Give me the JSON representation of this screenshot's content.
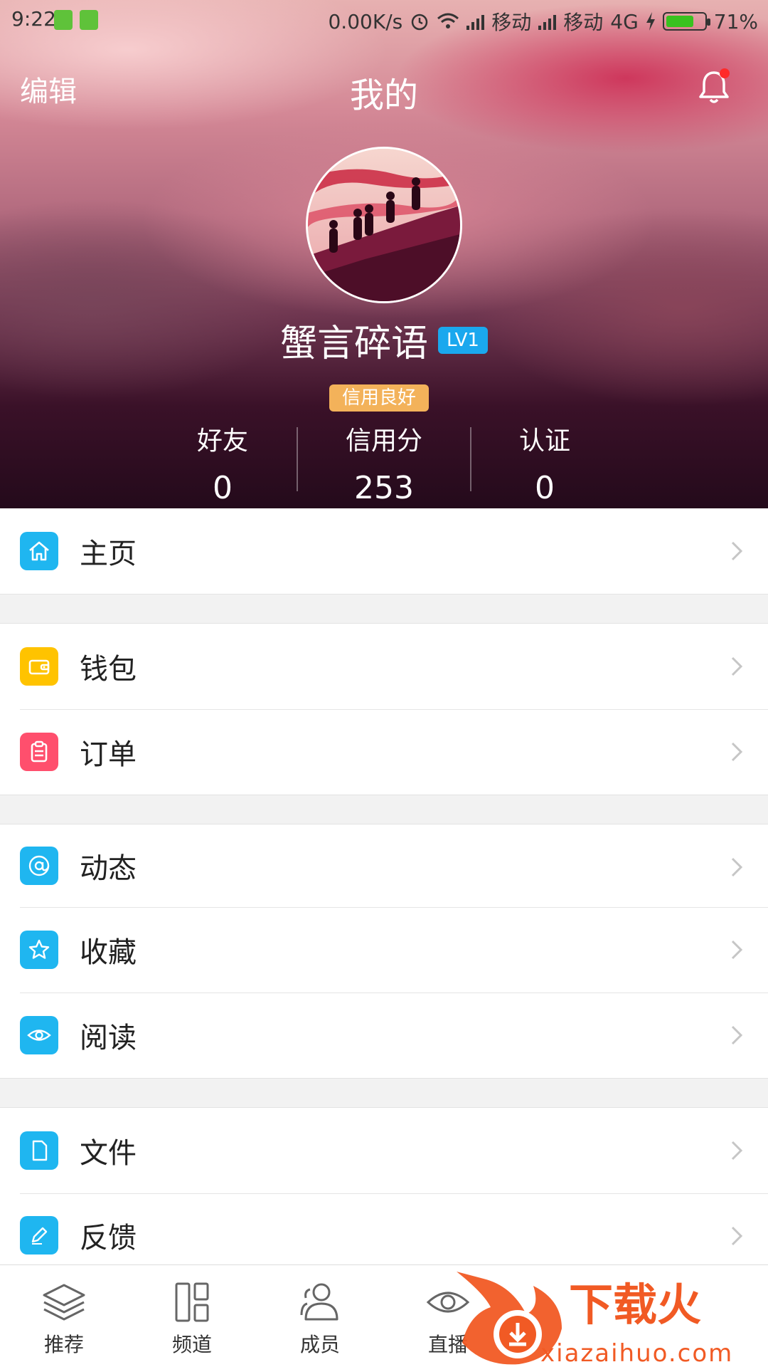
{
  "status_bar": {
    "time": "9:22",
    "net_speed": "0.00K/s",
    "carrier1": "移动",
    "carrier2": "移动",
    "network": "4G",
    "battery": "71%",
    "battery_level": 0.71
  },
  "header": {
    "edit_label": "编辑",
    "title": "我的"
  },
  "profile": {
    "name": "蟹言碎语",
    "level": "LV1",
    "credit_badge": "信用良好",
    "stats": [
      {
        "label": "好友",
        "value": "0"
      },
      {
        "label": "信用分",
        "value": "253"
      },
      {
        "label": "认证",
        "value": "0"
      }
    ]
  },
  "menu": {
    "home": "主页",
    "wallet": "钱包",
    "orders": "订单",
    "activity": "动态",
    "favorites": "收藏",
    "reading": "阅读",
    "files": "文件",
    "feedback": "反馈"
  },
  "colors": {
    "accent_blue": "#1fb6f0",
    "wallet_yellow": "#ffc300",
    "orders_red": "#ff4f6d",
    "badge_orange": "#f3b25a",
    "level_blue": "#1aa8ee"
  },
  "tabs": [
    {
      "label": "推荐",
      "icon": "layers-icon"
    },
    {
      "label": "频道",
      "icon": "grid-icon"
    },
    {
      "label": "成员",
      "icon": "people-icon"
    },
    {
      "label": "直播",
      "icon": "eye-icon"
    }
  ],
  "watermark": {
    "brand": "下载火",
    "url": "xiazaihuo.com"
  }
}
